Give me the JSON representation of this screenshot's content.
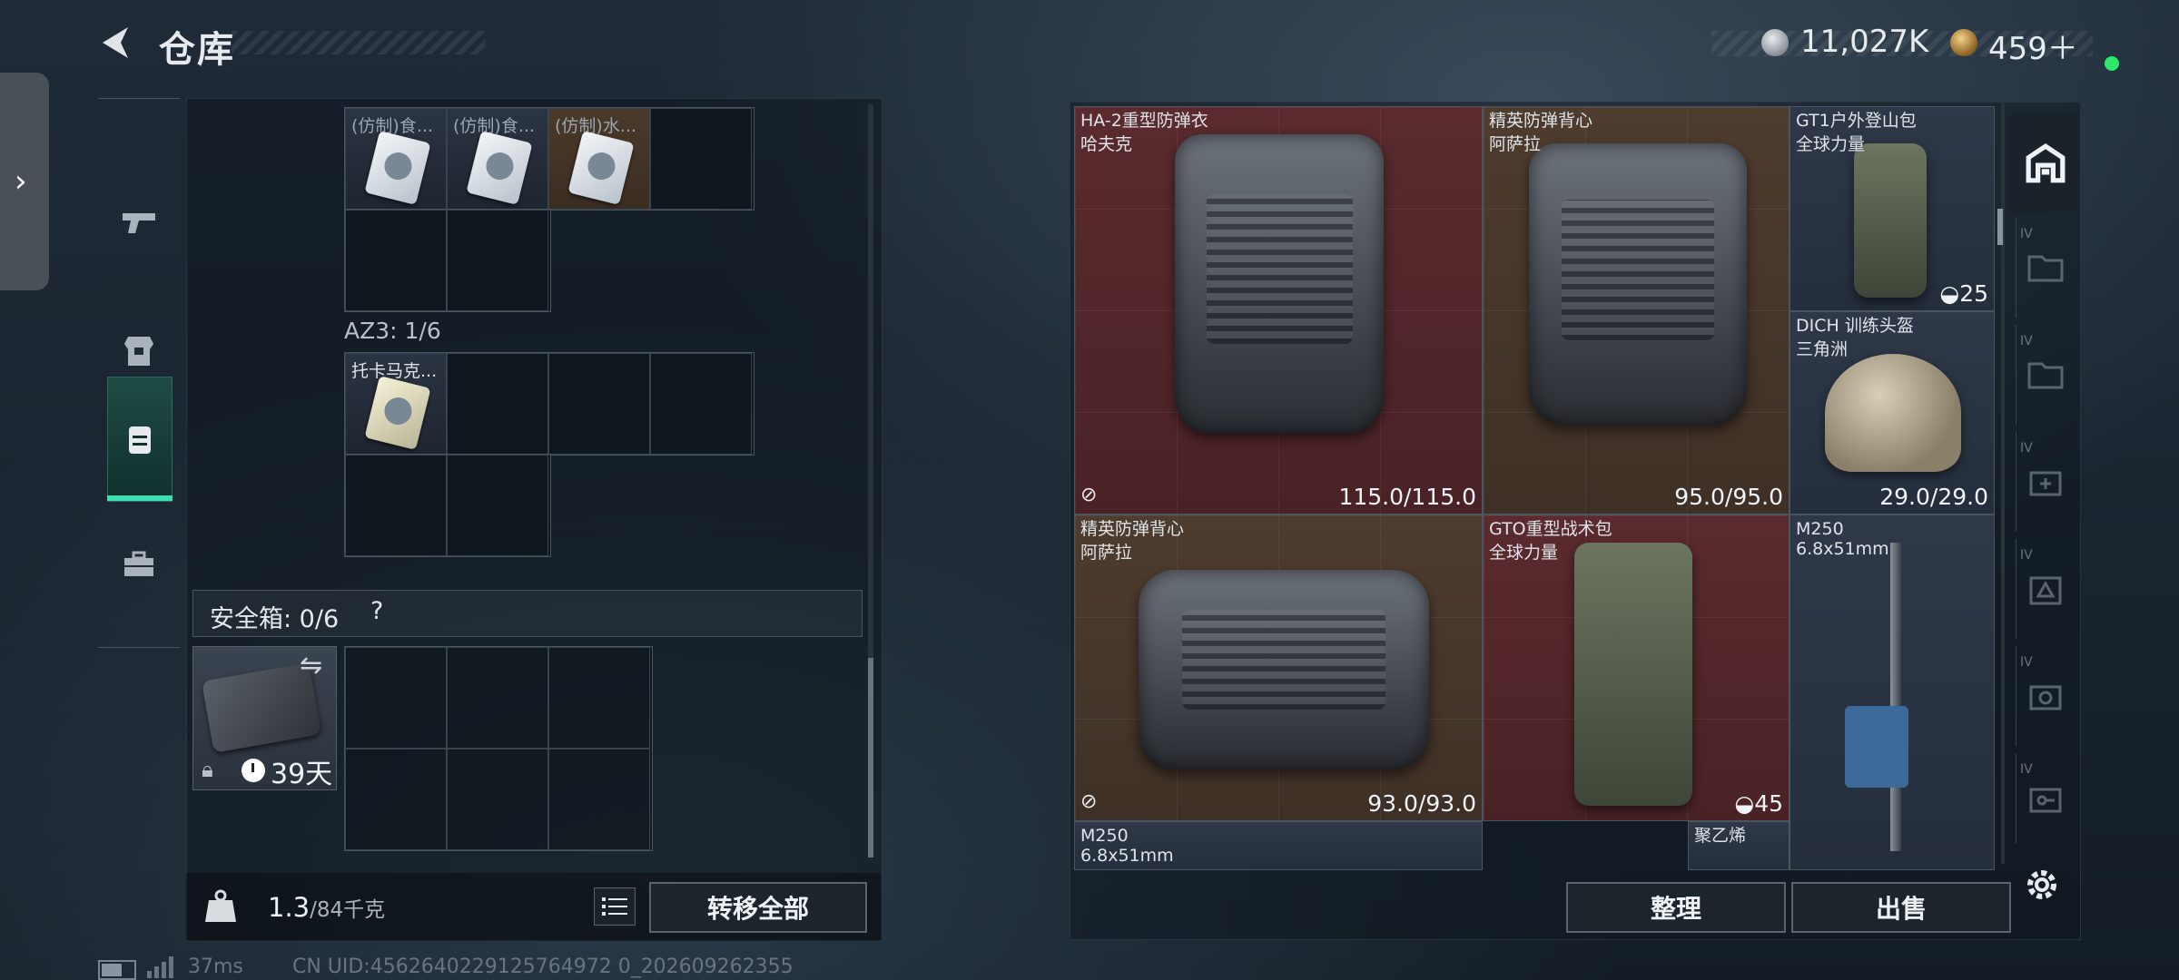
{
  "header": {
    "title": "仓库"
  },
  "currency": {
    "silver": "11,027K",
    "gold": "459＋"
  },
  "left": {
    "top_items": [
      "(仿制)食...",
      "(仿制)食...",
      "(仿制)水..."
    ],
    "az3_label": "AZ3: 1/6",
    "az3_item": "托卡马克...",
    "safe_box_label": "安全箱: 0/6",
    "safe_box_help": "?",
    "case_days": "39天",
    "weight_current": "1.3",
    "weight_max": "/84千克",
    "transfer_all": "转移全部"
  },
  "status": {
    "ping": "37ms",
    "uid": "CN UID:4562640229125764972 0_202609262355"
  },
  "right": {
    "items": [
      {
        "name": "HA-2重型防弹衣",
        "sub": "哈夫克",
        "value": "115.0/115.0"
      },
      {
        "name": "精英防弹背心",
        "sub": "阿萨拉",
        "value": "95.0/95.0"
      },
      {
        "name": "GT1户外登山包",
        "sub": "全球力量",
        "value": "25"
      },
      {
        "name": "DICH 训练头盔",
        "sub": "三角洲",
        "value": "29.0/29.0"
      },
      {
        "name": "精英防弹背心",
        "sub": "阿萨拉",
        "value": "93.0/93.0"
      },
      {
        "name": "GTO重型战术包",
        "sub": "全球力量",
        "value": "45"
      },
      {
        "name": "M250",
        "sub": "6.8x51mm",
        "value": ""
      },
      {
        "name": "M250",
        "sub": "6.8x51mm",
        "value": ""
      },
      {
        "name": "聚乙烯",
        "sub": "",
        "value": ""
      }
    ],
    "sort": "整理",
    "sell": "出售"
  },
  "right_tabs": [
    "IV",
    "IV",
    "IV",
    "IV",
    "IV",
    "IV"
  ]
}
